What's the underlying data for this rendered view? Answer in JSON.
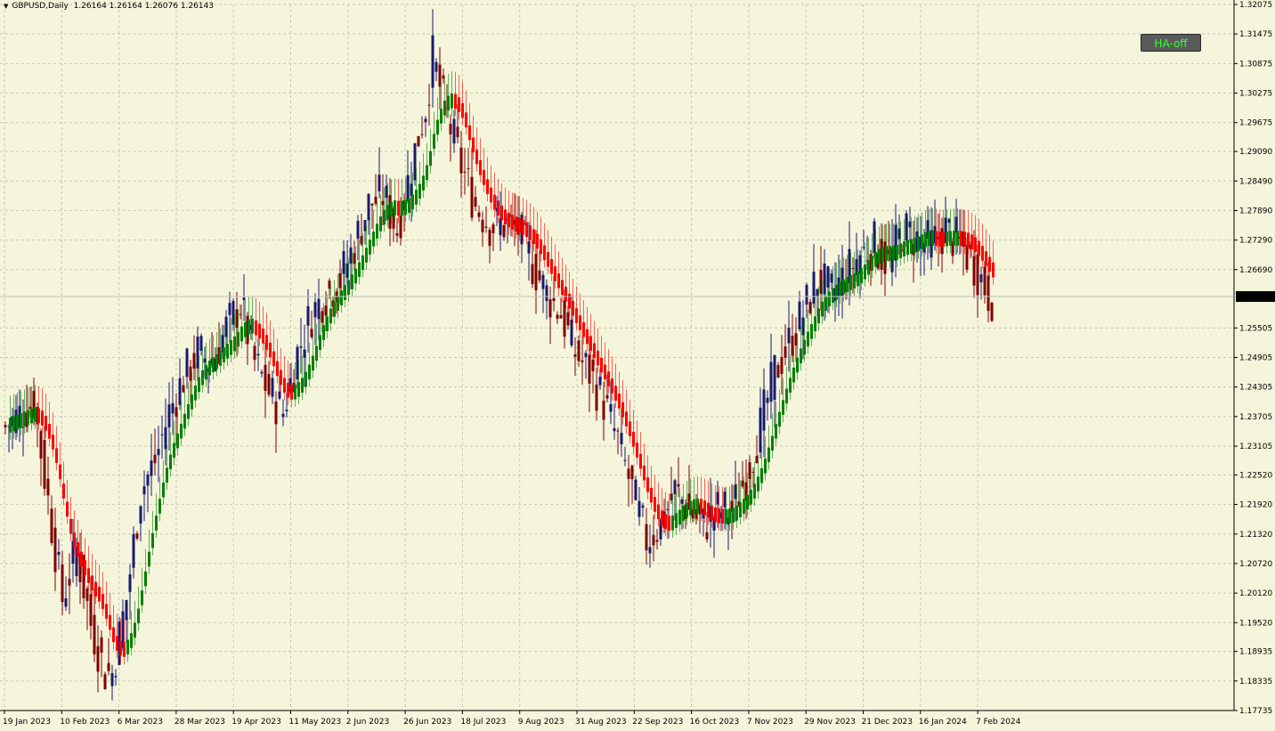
{
  "header": {
    "symbol": "GBPUSD,Daily",
    "ohlc": "1.26164 1.26164 1.26076 1.26143"
  },
  "button": {
    "label": "HA-off"
  },
  "colors": {
    "background": "#F5F5DC",
    "grid": "#c8c8b4",
    "bull_candle": "#191970",
    "bear_candle": "#800000",
    "ha_bull": "#008000",
    "ha_bear": "#FF0000",
    "price_label_bg": "#000000",
    "price_label_text": "#FFFFFF",
    "button_text": "#33ff33"
  },
  "chart_data": {
    "type": "candlestick",
    "price_axis": {
      "ylim": [
        1.17735,
        1.32075
      ],
      "ticks": [
        "1.32075",
        "1.31475",
        "1.30875",
        "1.30275",
        "1.29675",
        "1.29090",
        "1.28490",
        "1.27890",
        "1.27290",
        "1.26690",
        "1.25505",
        "1.24905",
        "1.24305",
        "1.23705",
        "1.23105",
        "1.22520",
        "1.21920",
        "1.21320",
        "1.20720",
        "1.20120",
        "1.19520",
        "1.18935",
        "1.18335",
        "1.17735"
      ],
      "current_price": "1.26143"
    },
    "time_axis": {
      "labels": [
        "19 Jan 2023",
        "10 Feb 2023",
        "6 Mar 2023",
        "28 Mar 2023",
        "19 Apr 2023",
        "11 May 2023",
        "2 Jun 2023",
        "26 Jun 2023",
        "18 Jul 2023",
        "9 Aug 2023",
        "31 Aug 2023",
        "22 Sep 2023",
        "16 Oct 2023",
        "7 Nov 2023",
        "29 Nov 2023",
        "21 Dec 2023",
        "16 Jan 2024",
        "7 Feb 2024"
      ]
    },
    "series": [
      {
        "name": "GBPUSD",
        "kind": "close_path",
        "points": [
          [
            0,
            1.235
          ],
          [
            8,
            1.24
          ],
          [
            12,
            1.22
          ],
          [
            16,
            1.2
          ],
          [
            20,
            1.21
          ],
          [
            24,
            1.195
          ],
          [
            28,
            1.185
          ],
          [
            30,
            1.185
          ],
          [
            34,
            1.2
          ],
          [
            38,
            1.222
          ],
          [
            42,
            1.228
          ],
          [
            46,
            1.238
          ],
          [
            50,
            1.245
          ],
          [
            54,
            1.25
          ],
          [
            58,
            1.248
          ],
          [
            62,
            1.255
          ],
          [
            66,
            1.26
          ],
          [
            70,
            1.248
          ],
          [
            74,
            1.242
          ],
          [
            78,
            1.238
          ],
          [
            82,
            1.25
          ],
          [
            86,
            1.258
          ],
          [
            90,
            1.262
          ],
          [
            94,
            1.265
          ],
          [
            98,
            1.272
          ],
          [
            102,
            1.28
          ],
          [
            106,
            1.282
          ],
          [
            110,
            1.275
          ],
          [
            114,
            1.288
          ],
          [
            118,
            1.3
          ],
          [
            120,
            1.31
          ],
          [
            124,
            1.298
          ],
          [
            128,
            1.288
          ],
          [
            132,
            1.28
          ],
          [
            136,
            1.276
          ],
          [
            140,
            1.276
          ],
          [
            144,
            1.275
          ],
          [
            148,
            1.268
          ],
          [
            152,
            1.262
          ],
          [
            156,
            1.258
          ],
          [
            160,
            1.25
          ],
          [
            164,
            1.246
          ],
          [
            168,
            1.24
          ],
          [
            172,
            1.232
          ],
          [
            176,
            1.222
          ],
          [
            180,
            1.212
          ],
          [
            184,
            1.215
          ],
          [
            188,
            1.222
          ],
          [
            192,
            1.218
          ],
          [
            196,
            1.215
          ],
          [
            200,
            1.218
          ],
          [
            204,
            1.218
          ],
          [
            208,
            1.225
          ],
          [
            212,
            1.235
          ],
          [
            216,
            1.246
          ],
          [
            220,
            1.252
          ],
          [
            224,
            1.258
          ],
          [
            228,
            1.265
          ],
          [
            232,
            1.262
          ],
          [
            236,
            1.266
          ],
          [
            240,
            1.27
          ],
          [
            244,
            1.272
          ],
          [
            248,
            1.268
          ],
          [
            252,
            1.275
          ],
          [
            256,
            1.273
          ],
          [
            260,
            1.272
          ],
          [
            264,
            1.275
          ],
          [
            268,
            1.272
          ],
          [
            272,
            1.268
          ],
          [
            276,
            1.262
          ],
          [
            277,
            1.2614
          ]
        ]
      }
    ],
    "heikin_ashi_overlay": true,
    "grid": true,
    "last_price_label": "1.26143"
  }
}
